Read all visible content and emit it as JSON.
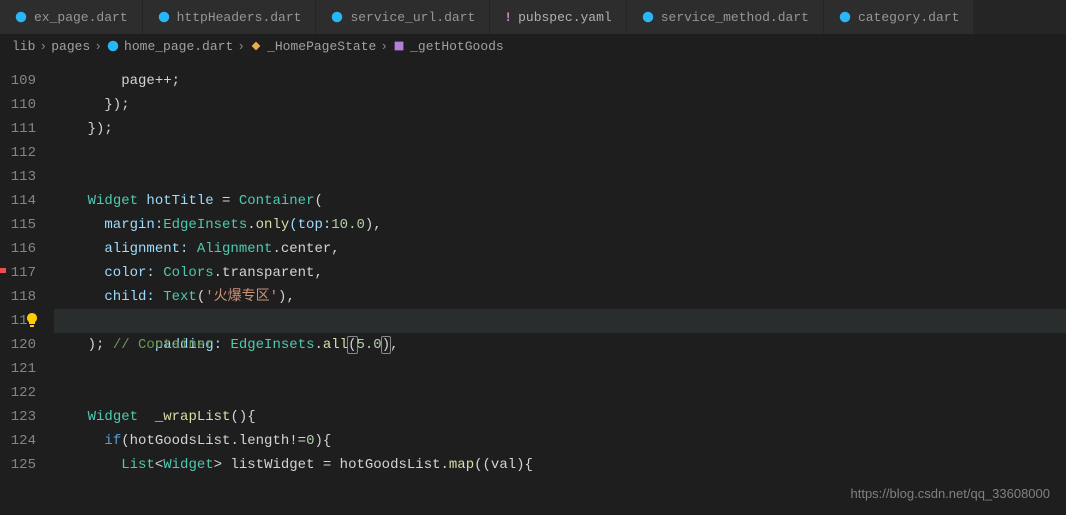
{
  "tabs": [
    {
      "label": "ex_page.dart",
      "type": "dart"
    },
    {
      "label": "httpHeaders.dart",
      "type": "dart"
    },
    {
      "label": "service_url.dart",
      "type": "dart"
    },
    {
      "label": "pubspec.yaml",
      "type": "yaml"
    },
    {
      "label": "service_method.dart",
      "type": "dart"
    },
    {
      "label": "category.dart",
      "type": "dart"
    }
  ],
  "breadcrumbs": {
    "seg0": "lib",
    "seg1": "pages",
    "seg2": "home_page.dart",
    "seg3": "_HomePageState",
    "seg4": "_getHotGoods"
  },
  "line_numbers": [
    "109",
    "110",
    "111",
    "112",
    "113",
    "114",
    "115",
    "116",
    "117",
    "118",
    "119",
    "120",
    "121",
    "122",
    "123",
    "124",
    "125"
  ],
  "code": {
    "l109a": "        page++;",
    "l110a": "      });",
    "l111a": "    });",
    "l114kw": "Widget",
    "l114var": " hotTitle ",
    "l114eq": "= ",
    "l114cls": "Container",
    "l114p": "(",
    "l115lbl": "      margin:",
    "l115cls": "EdgeInsets",
    "l115dot": ".",
    "l115fn": "only",
    "l115op": "(top:",
    "l115num": "10.0",
    "l115cl": "),",
    "l116lbl": "      alignment: ",
    "l116cls": "Alignment",
    "l116dot": ".center,",
    "l117lbl": "      color: ",
    "l117cls": "Colors",
    "l117dot": ".transparent,",
    "l118lbl": "      child: ",
    "l118cls": "Text",
    "l118p1": "(",
    "l118str": "'火爆专区'",
    "l118p2": "),",
    "l119lbl": "      padding: ",
    "l119cls": "EdgeInsets",
    "l119dot": ".",
    "l119fn": "all",
    "l119p1": "(",
    "l119num": "5.0",
    "l119p2": ")",
    "l119cm": ",",
    "l120a": "    ); ",
    "l120c": "// Container",
    "l123kw": "Widget",
    "l123sp": "  ",
    "l123fn": "_wrapList",
    "l123p": "(){",
    "l124kw": "if",
    "l124a": "(hotGoodsList.length!=",
    "l124num": "0",
    "l124b": "){",
    "l125cls1": "List",
    "l125lt": "<",
    "l125cls2": "Widget",
    "l125gt": "> listWidget = hotGoodsList.",
    "l125fn": "map",
    "l125p": "((val){"
  },
  "watermark": "https://blog.csdn.net/qq_33608000"
}
